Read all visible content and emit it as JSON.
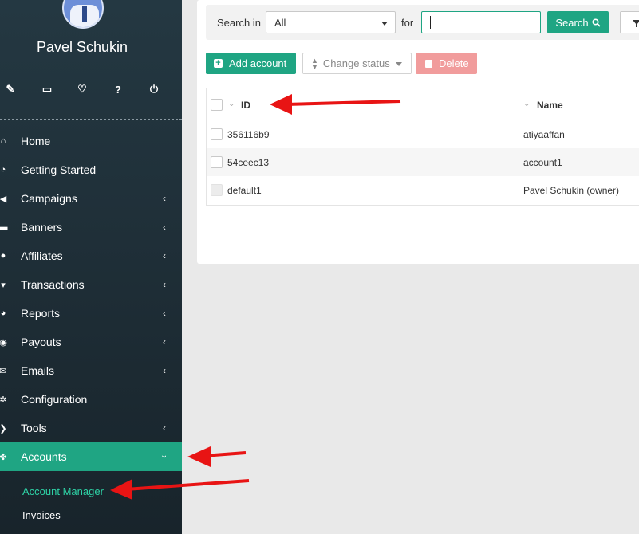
{
  "user": {
    "name": "Pavel Schukin"
  },
  "tools": [
    {
      "icon": "pencil-icon",
      "glyph": "✎"
    },
    {
      "icon": "monitor-icon",
      "glyph": "▭"
    },
    {
      "icon": "heartbeat-icon",
      "glyph": "♡"
    },
    {
      "icon": "help-icon",
      "glyph": "?"
    },
    {
      "icon": "power-icon",
      "glyph": "⏻"
    }
  ],
  "menu": [
    {
      "label": "Home",
      "icon": "home-icon",
      "glyph": "⌂",
      "has_sub": false
    },
    {
      "label": "Getting Started",
      "icon": "dial-icon",
      "glyph": "◔",
      "has_sub": false
    },
    {
      "label": "Campaigns",
      "icon": "bullhorn-icon",
      "glyph": "◀",
      "has_sub": true
    },
    {
      "label": "Banners",
      "icon": "banner-icon",
      "glyph": "▬",
      "has_sub": true
    },
    {
      "label": "Affiliates",
      "icon": "users-icon",
      "glyph": "●",
      "has_sub": true
    },
    {
      "label": "Transactions",
      "icon": "basket-icon",
      "glyph": "▾",
      "has_sub": true
    },
    {
      "label": "Reports",
      "icon": "pie-icon",
      "glyph": "◕",
      "has_sub": true
    },
    {
      "label": "Payouts",
      "icon": "money-bag-icon",
      "glyph": "◉",
      "has_sub": true
    },
    {
      "label": "Emails",
      "icon": "envelope-icon",
      "glyph": "✉",
      "has_sub": true
    },
    {
      "label": "Configuration",
      "icon": "cog-icon",
      "glyph": "✲",
      "has_sub": false
    },
    {
      "label": "Tools",
      "icon": "wrench-icon",
      "glyph": "❯",
      "has_sub": true
    },
    {
      "label": "Accounts",
      "icon": "accounts-icon",
      "glyph": "✤",
      "has_sub": true,
      "active": true
    }
  ],
  "submenu": [
    {
      "label": "Account Manager",
      "current": true
    },
    {
      "label": "Invoices",
      "current": false
    }
  ],
  "search": {
    "search_in_label": "Search in",
    "scope_value": "All",
    "for_label": "for",
    "query_value": "",
    "search_button": "Search"
  },
  "actions": {
    "add_label": "Add account",
    "status_label": "Change status",
    "delete_label": "Delete"
  },
  "table": {
    "headers": {
      "id": "ID",
      "name": "Name"
    },
    "rows": [
      {
        "id": "356116b9",
        "name": "atiyaaffan",
        "checkbox_enabled": true
      },
      {
        "id": "54ceec13",
        "name": "account1",
        "checkbox_enabled": true
      },
      {
        "id": "default1",
        "name": "Pavel Schukin (owner)",
        "checkbox_enabled": false
      }
    ]
  },
  "colors": {
    "accent": "#1fa583",
    "sidebar": "#1f2f38",
    "arrow": "#e81414",
    "delete": "#f19c9c"
  }
}
